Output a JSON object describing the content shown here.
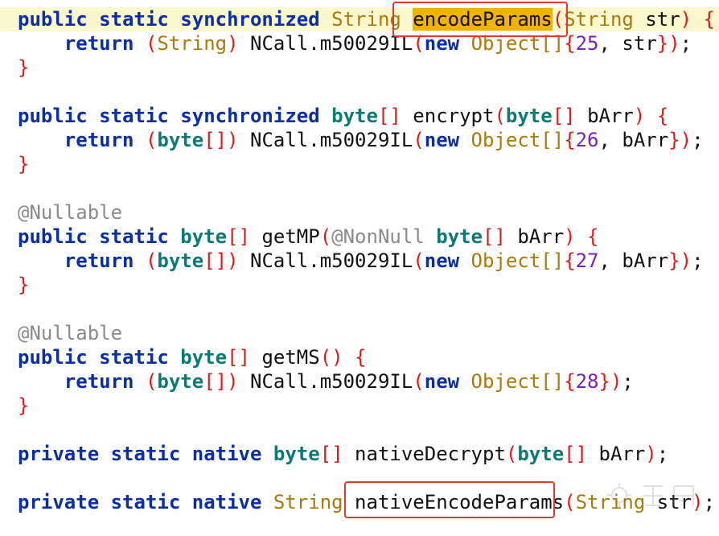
{
  "editor": {
    "lines": [
      {
        "current": true,
        "tokens": [
          {
            "t": "public static synchronized ",
            "c": "kw"
          },
          {
            "t": "String ",
            "c": "typ"
          },
          {
            "t": "encodeParams",
            "c": "hl"
          },
          {
            "t": "(",
            "c": "br"
          },
          {
            "t": "String ",
            "c": "typ"
          },
          {
            "t": "str",
            "c": "txt"
          },
          {
            "t": ") {",
            "c": "br"
          }
        ]
      },
      {
        "tokens": [
          {
            "t": "    return ",
            "c": "kw"
          },
          {
            "t": "(",
            "c": "br"
          },
          {
            "t": "String",
            "c": "typ"
          },
          {
            "t": ") ",
            "c": "br"
          },
          {
            "t": "NCall.m50029IL",
            "c": "txt"
          },
          {
            "t": "(",
            "c": "br"
          },
          {
            "t": "new ",
            "c": "kw"
          },
          {
            "t": "Object[]",
            "c": "typ"
          },
          {
            "t": "{",
            "c": "br"
          },
          {
            "t": "25",
            "c": "num"
          },
          {
            "t": ", str",
            "c": "txt"
          },
          {
            "t": "})",
            "c": "br"
          },
          {
            "t": ";",
            "c": "txt"
          }
        ]
      },
      {
        "tokens": [
          {
            "t": "}",
            "c": "br"
          }
        ]
      },
      {
        "tokens": []
      },
      {
        "tokens": [
          {
            "t": "public static synchronized ",
            "c": "kw"
          },
          {
            "t": "byte",
            "c": "prim"
          },
          {
            "t": "[] ",
            "c": "br"
          },
          {
            "t": "encrypt",
            "c": "txt"
          },
          {
            "t": "(",
            "c": "br"
          },
          {
            "t": "byte",
            "c": "prim"
          },
          {
            "t": "[] ",
            "c": "br"
          },
          {
            "t": "bArr",
            "c": "txt"
          },
          {
            "t": ") {",
            "c": "br"
          }
        ]
      },
      {
        "tokens": [
          {
            "t": "    return ",
            "c": "kw"
          },
          {
            "t": "(",
            "c": "br"
          },
          {
            "t": "byte",
            "c": "prim"
          },
          {
            "t": "[]) ",
            "c": "br"
          },
          {
            "t": "NCall.m50029IL",
            "c": "txt"
          },
          {
            "t": "(",
            "c": "br"
          },
          {
            "t": "new ",
            "c": "kw"
          },
          {
            "t": "Object[]",
            "c": "typ"
          },
          {
            "t": "{",
            "c": "br"
          },
          {
            "t": "26",
            "c": "num"
          },
          {
            "t": ", bArr",
            "c": "txt"
          },
          {
            "t": "})",
            "c": "br"
          },
          {
            "t": ";",
            "c": "txt"
          }
        ]
      },
      {
        "tokens": [
          {
            "t": "}",
            "c": "br"
          }
        ]
      },
      {
        "tokens": []
      },
      {
        "tokens": [
          {
            "t": "@Nullable",
            "c": "ann"
          }
        ]
      },
      {
        "tokens": [
          {
            "t": "public static ",
            "c": "kw"
          },
          {
            "t": "byte",
            "c": "prim"
          },
          {
            "t": "[] ",
            "c": "br"
          },
          {
            "t": "getMP",
            "c": "txt"
          },
          {
            "t": "(",
            "c": "br"
          },
          {
            "t": "@NonNull ",
            "c": "ann"
          },
          {
            "t": "byte",
            "c": "prim"
          },
          {
            "t": "[] ",
            "c": "br"
          },
          {
            "t": "bArr",
            "c": "txt"
          },
          {
            "t": ") {",
            "c": "br"
          }
        ]
      },
      {
        "tokens": [
          {
            "t": "    return ",
            "c": "kw"
          },
          {
            "t": "(",
            "c": "br"
          },
          {
            "t": "byte",
            "c": "prim"
          },
          {
            "t": "[]) ",
            "c": "br"
          },
          {
            "t": "NCall.m50029IL",
            "c": "txt"
          },
          {
            "t": "(",
            "c": "br"
          },
          {
            "t": "new ",
            "c": "kw"
          },
          {
            "t": "Object[]",
            "c": "typ"
          },
          {
            "t": "{",
            "c": "br"
          },
          {
            "t": "27",
            "c": "num"
          },
          {
            "t": ", bArr",
            "c": "txt"
          },
          {
            "t": "})",
            "c": "br"
          },
          {
            "t": ";",
            "c": "txt"
          }
        ]
      },
      {
        "tokens": [
          {
            "t": "}",
            "c": "br"
          }
        ]
      },
      {
        "tokens": []
      },
      {
        "tokens": [
          {
            "t": "@Nullable",
            "c": "ann"
          }
        ]
      },
      {
        "tokens": [
          {
            "t": "public static ",
            "c": "kw"
          },
          {
            "t": "byte",
            "c": "prim"
          },
          {
            "t": "[] ",
            "c": "br"
          },
          {
            "t": "getMS",
            "c": "txt"
          },
          {
            "t": "() {",
            "c": "br"
          }
        ]
      },
      {
        "tokens": [
          {
            "t": "    return ",
            "c": "kw"
          },
          {
            "t": "(",
            "c": "br"
          },
          {
            "t": "byte",
            "c": "prim"
          },
          {
            "t": "[]) ",
            "c": "br"
          },
          {
            "t": "NCall.m50029IL",
            "c": "txt"
          },
          {
            "t": "(",
            "c": "br"
          },
          {
            "t": "new ",
            "c": "kw"
          },
          {
            "t": "Object[]",
            "c": "typ"
          },
          {
            "t": "{",
            "c": "br"
          },
          {
            "t": "28",
            "c": "num"
          },
          {
            "t": "})",
            "c": "br"
          },
          {
            "t": ";",
            "c": "txt"
          }
        ]
      },
      {
        "tokens": [
          {
            "t": "}",
            "c": "br"
          }
        ]
      },
      {
        "tokens": []
      },
      {
        "tokens": [
          {
            "t": "private static native ",
            "c": "kw"
          },
          {
            "t": "byte",
            "c": "prim"
          },
          {
            "t": "[] ",
            "c": "br"
          },
          {
            "t": "nativeDecrypt",
            "c": "txt"
          },
          {
            "t": "(",
            "c": "br"
          },
          {
            "t": "byte",
            "c": "prim"
          },
          {
            "t": "[] ",
            "c": "br"
          },
          {
            "t": "bArr",
            "c": "txt"
          },
          {
            "t": ")",
            "c": "br"
          },
          {
            "t": ";",
            "c": "txt"
          }
        ]
      },
      {
        "tokens": []
      },
      {
        "tokens": [
          {
            "t": "private static native ",
            "c": "kw"
          },
          {
            "t": "String ",
            "c": "typ"
          },
          {
            "t": "nativeEncodeParams",
            "c": "txt"
          },
          {
            "t": "(",
            "c": "br"
          },
          {
            "t": "String ",
            "c": "typ"
          },
          {
            "t": "str",
            "c": "txt"
          },
          {
            "t": ")",
            "c": "br"
          },
          {
            "t": ";",
            "c": "txt"
          }
        ]
      }
    ]
  },
  "colors": {
    "keyword": "#0a2daa",
    "type": "#a97a08",
    "primitive": "#0b7a75",
    "bracket": "#e21919",
    "number": "#7722bb",
    "annotation": "#8a8a8a",
    "search_highlight": "#f0b400",
    "current_line": "#fbf8d0",
    "callout_box": "#e23a2e"
  },
  "icons": {
    "watermark": "brand-watermark-icon"
  }
}
